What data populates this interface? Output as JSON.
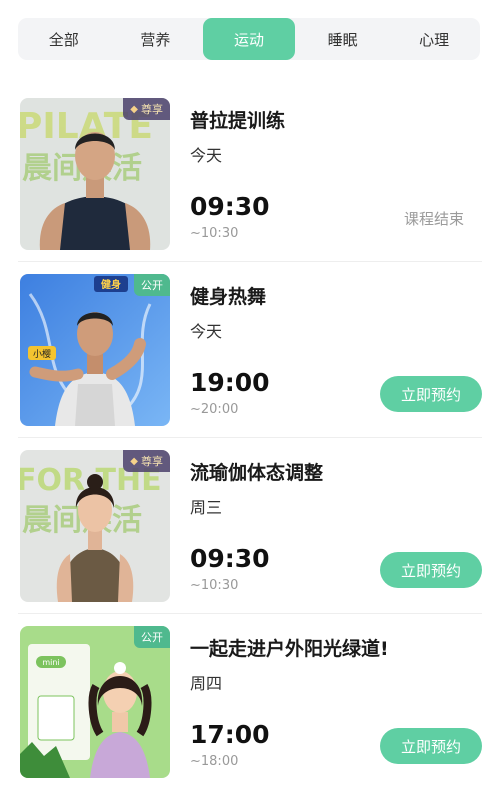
{
  "tabs": [
    {
      "label": "全部",
      "active": false
    },
    {
      "label": "营养",
      "active": false
    },
    {
      "label": "运动",
      "active": true
    },
    {
      "label": "睡眠",
      "active": false
    },
    {
      "label": "心理",
      "active": false
    }
  ],
  "accent_color": "#5fcfa3",
  "courses": [
    {
      "title": "普拉提训练",
      "day": "今天",
      "start": "09:30",
      "end": "~10:30",
      "badge": "尊享",
      "badge_type": "vip",
      "status": "课程结束",
      "action": ""
    },
    {
      "title": "健身热舞",
      "day": "今天",
      "start": "19:00",
      "end": "~20:00",
      "badge": "公开",
      "badge_type": "public",
      "status": "",
      "action": "立即预约"
    },
    {
      "title": "流瑜伽体态调整",
      "day": "周三",
      "start": "09:30",
      "end": "~10:30",
      "badge": "尊享",
      "badge_type": "vip",
      "status": "",
      "action": "立即预约"
    },
    {
      "title": "一起走进户外阳光绿道!",
      "day": "周四",
      "start": "17:00",
      "end": "~18:00",
      "badge": "公开",
      "badge_type": "public",
      "status": "",
      "action": "立即预约"
    }
  ],
  "thumb_texts": {
    "c0_big": "PILATE",
    "c0_cn": "晨间焕活",
    "c1_tag": "健身",
    "c1_name": "小樱",
    "c2_big": "FOR THE",
    "c2_cn": "晨间焕活",
    "c3_tag": "mini"
  }
}
